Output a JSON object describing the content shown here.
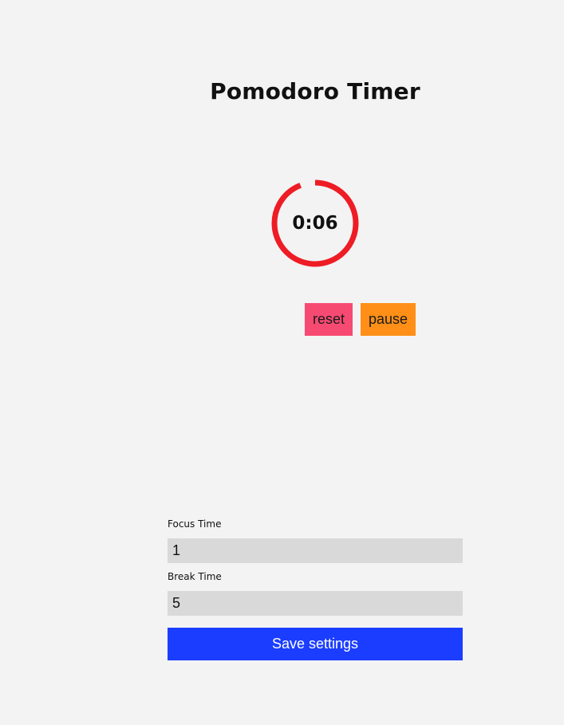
{
  "header": {
    "title": "Pomodoro Timer"
  },
  "timer": {
    "display": "0:06",
    "progress_fraction": 0.94,
    "ring_color": "#ee1c25"
  },
  "controls": {
    "reset_label": "reset",
    "pause_label": "pause",
    "reset_color": "#f74a72",
    "pause_color": "#ff8f16"
  },
  "settings": {
    "focus_label": "Focus Time",
    "focus_value": "1",
    "break_label": "Break Time",
    "break_value": "5",
    "save_label": "Save settings",
    "save_color": "#1b3dff"
  }
}
